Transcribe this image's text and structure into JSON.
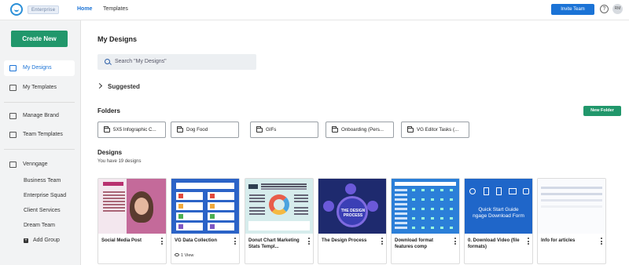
{
  "topbar": {
    "badge": "Enterprise",
    "nav_home": "Home",
    "nav_templates": "Templates",
    "invite": "Invite Team",
    "help": "?",
    "avatar": "RM"
  },
  "sidebar": {
    "create": "Create New",
    "items": [
      {
        "label": "My Designs",
        "icon": "my-designs-icon",
        "active": true
      },
      {
        "label": "My Templates",
        "icon": "templates-icon"
      },
      {
        "label": "Manage Brand",
        "icon": "brand-icon"
      },
      {
        "label": "Team Templates",
        "icon": "team-templates-icon"
      },
      {
        "label": "Venngage",
        "icon": "venngage-org-icon"
      }
    ],
    "groups": [
      "Business Team",
      "Enterprise Squad",
      "Client Services",
      "Dream Team"
    ],
    "add_group": "Add Group"
  },
  "main": {
    "title": "My Designs",
    "search_placeholder": "Search \"My Designs\"",
    "suggested": "Suggested",
    "folders_title": "Folders",
    "new_folder": "New Folder",
    "folders": [
      "5X5 Infographic C...",
      "Dog Food",
      "GIFs",
      "Onboarding (Pers...",
      "VG Editor Tasks (..."
    ],
    "designs_title": "Designs",
    "designs_count": "You have 19 designs",
    "designs": [
      {
        "title": "Social Media Post"
      },
      {
        "title": "VG Data Collection",
        "views": "1 View"
      },
      {
        "title": "Donut Chart Marketing Stats Templ..."
      },
      {
        "title": "The Design Process",
        "thumb_text": "THE DESIGN PROCESS"
      },
      {
        "title": "Download format features comp"
      },
      {
        "title": "0. Download Video (file formats)",
        "thumb_text": "Quick Start Guide\nngage Download Form"
      },
      {
        "title": "Info for articles"
      }
    ]
  },
  "colors": {
    "primary": "#1b73d6",
    "green": "#21976b"
  }
}
